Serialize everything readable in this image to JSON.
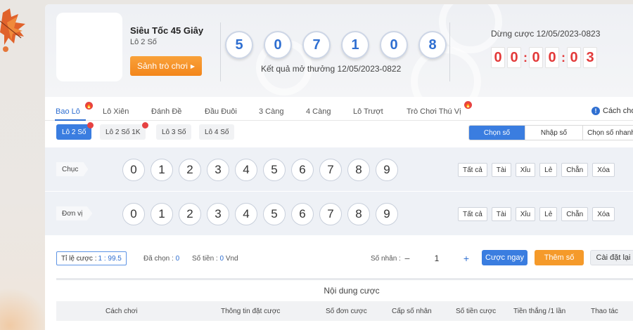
{
  "header": {
    "game_title": "Siêu Tốc 45 Giây",
    "game_subtitle": "Lô 2 Số",
    "lobby_button": "Sảnh trò chơi",
    "result_digits": [
      "5",
      "0",
      "7",
      "1",
      "0",
      "8"
    ],
    "result_text": "Kết quả mở thưởng 12/05/2023-0822",
    "stop_text": "Dừng cược 12/05/2023-0823",
    "countdown": [
      "0",
      "0",
      "0",
      "0",
      "0",
      "3"
    ]
  },
  "main_tabs": [
    {
      "label": "Bao Lô",
      "active": true,
      "hot": true
    },
    {
      "label": "Lô Xiên"
    },
    {
      "label": "Đánh Đề"
    },
    {
      "label": "Đầu Đuôi"
    },
    {
      "label": "3 Càng"
    },
    {
      "label": "4 Càng"
    },
    {
      "label": "Lô Trượt"
    },
    {
      "label": "Trò Chơi Thú Vị",
      "hot": true
    }
  ],
  "how_to_play": "Cách chơi",
  "sub_tabs": [
    {
      "label": "Lô 2 Số",
      "active": true,
      "hot": true
    },
    {
      "label": "Lô 2 Số 1K",
      "hot": true
    },
    {
      "label": "Lô 3 Số"
    },
    {
      "label": "Lô 4 Số"
    }
  ],
  "modes": [
    {
      "label": "Chọn số",
      "active": true
    },
    {
      "label": "Nhập số"
    },
    {
      "label": "Chọn số nhanh"
    }
  ],
  "rows": [
    {
      "label": "Chục",
      "numbers": [
        "0",
        "1",
        "2",
        "3",
        "4",
        "5",
        "6",
        "7",
        "8",
        "9"
      ],
      "quick": [
        "Tất cả",
        "Tài",
        "Xỉu",
        "Lẻ",
        "Chẵn",
        "Xóa"
      ]
    },
    {
      "label": "Đơn vị",
      "numbers": [
        "0",
        "1",
        "2",
        "3",
        "4",
        "5",
        "6",
        "7",
        "8",
        "9"
      ],
      "quick": [
        "Tất cả",
        "Tài",
        "Xỉu",
        "Lẻ",
        "Chẵn",
        "Xóa"
      ]
    }
  ],
  "bet": {
    "ratio_label": "Tỉ lệ cược :",
    "ratio_value": "1 : 99.5",
    "selected_label": "Đã chọn :",
    "selected_value": "0",
    "amount_label": "Số tiền :",
    "amount_value": "0",
    "amount_unit": "Vnd",
    "multiplier_label": "Số nhân :",
    "multiplier_value": "1",
    "bet_now": "Cược ngay",
    "add_number": "Thêm số",
    "reset": "Cài đặt lại"
  },
  "table": {
    "title": "Nội dung cược",
    "headers": [
      "Cách chơi",
      "Thông tin đặt cược",
      "Số đơn cược",
      "Cấp số nhân",
      "Số tiền cược",
      "Tiền thắng /1 lần",
      "Thao tác"
    ]
  },
  "colors": {
    "accent": "#3a7de0",
    "orange": "#f59a2a",
    "red": "#e33a3a"
  }
}
